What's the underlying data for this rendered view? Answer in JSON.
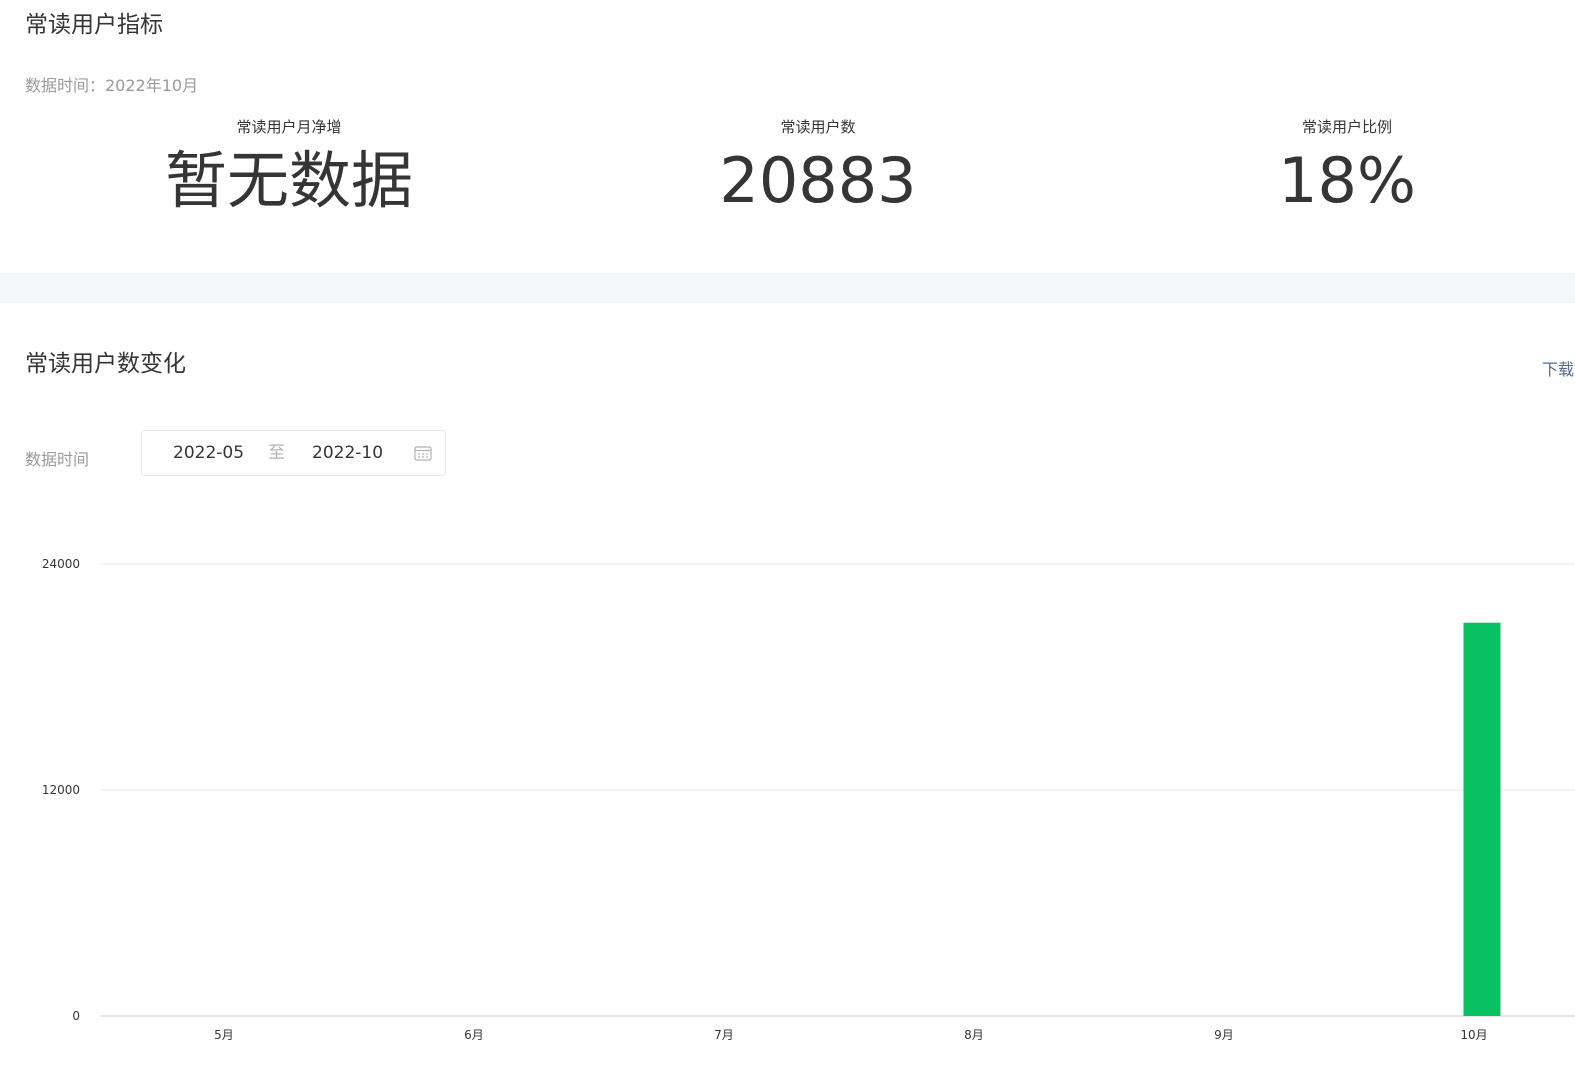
{
  "indicators": {
    "title": "常读用户指标",
    "data_time": "数据时间：2022年10月",
    "metrics": [
      {
        "label": "常读用户月净增",
        "value": "暂无数据"
      },
      {
        "label": "常读用户数",
        "value": "20883"
      },
      {
        "label": "常读用户比例",
        "value": "18%"
      }
    ]
  },
  "trend": {
    "title": "常读用户数变化",
    "download_label": "下载数据",
    "filter": {
      "label": "数据时间",
      "start": "2022-05",
      "separator": "至",
      "end": "2022-10"
    }
  },
  "colors": {
    "bar": "#07c160",
    "link": "#576b95",
    "band": "#f5f6f7"
  },
  "chart_data": {
    "type": "bar",
    "categories": [
      "5月",
      "6月",
      "7月",
      "8月",
      "9月",
      "10月"
    ],
    "values": [
      0,
      0,
      0,
      0,
      0,
      20883
    ],
    "title": "",
    "xlabel": "",
    "ylabel": "",
    "ylim": [
      0,
      24000
    ],
    "yticks": [
      0,
      12000,
      24000
    ],
    "grid": true
  }
}
